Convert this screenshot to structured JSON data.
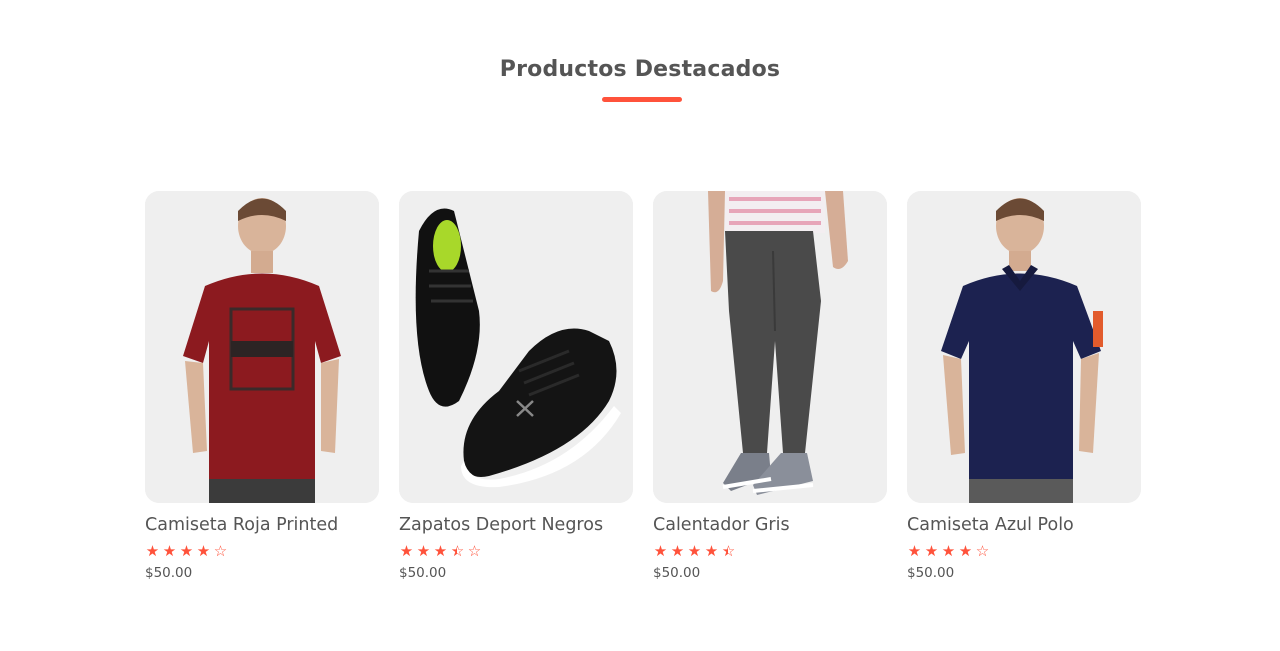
{
  "section": {
    "title": "Productos Destacados"
  },
  "colors": {
    "accent": "#ff523b",
    "text": "#555555",
    "thumb_bg": "#efefef"
  },
  "products": [
    {
      "name": "Camiseta Roja Printed",
      "rating": 4,
      "stars": [
        "star-full",
        "star-full",
        "star-full",
        "star-full",
        "star-empty"
      ],
      "price": "$50.00",
      "image": "red-printed-tshirt"
    },
    {
      "name": "Zapatos Deport Negros",
      "rating": 3.5,
      "stars": [
        "star-full",
        "star-full",
        "star-full",
        "star-half",
        "star-empty"
      ],
      "price": "$50.00",
      "image": "black-sport-shoes"
    },
    {
      "name": "Calentador Gris",
      "rating": 4.5,
      "stars": [
        "star-full",
        "star-full",
        "star-full",
        "star-full",
        "star-half"
      ],
      "price": "$50.00",
      "image": "grey-joggers"
    },
    {
      "name": "Camiseta Azul Polo",
      "rating": 4,
      "stars": [
        "star-full",
        "star-full",
        "star-full",
        "star-full",
        "star-empty"
      ],
      "price": "$50.00",
      "image": "navy-polo-shirt"
    }
  ]
}
